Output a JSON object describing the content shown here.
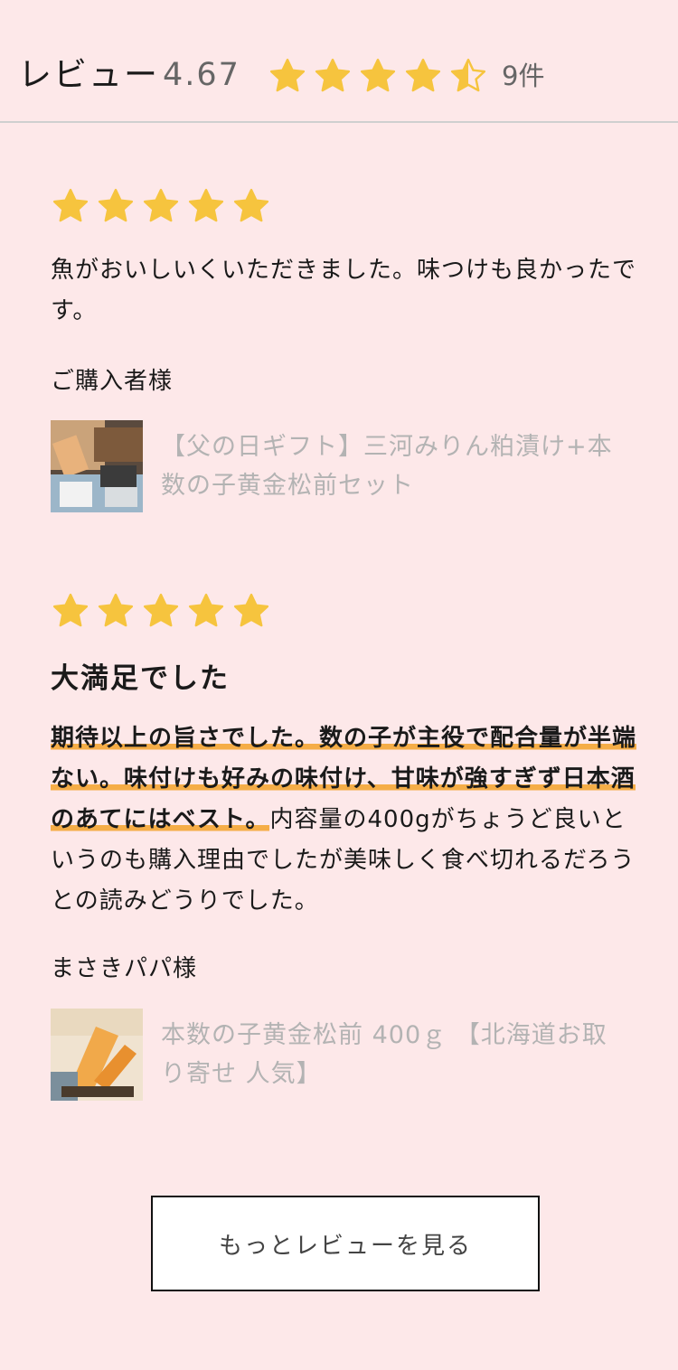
{
  "header": {
    "title": "レビュー",
    "score": "4.67",
    "rating": 4.67,
    "count": "9件"
  },
  "colors": {
    "background": "#fde8e9",
    "star": "#f6c43e",
    "highlight": "#f5ad47"
  },
  "reviews": [
    {
      "rating": 5,
      "body": "魚がおいしいくいただきました。味つけも良かったです。",
      "reviewer": "ご購入者様",
      "product_title": "【父の日ギフト】三河みりん粕漬け+本数の子黄金松前セット",
      "thumb_icon": "product-photo-fish-gift-set"
    },
    {
      "rating": 5,
      "title": "大満足でした",
      "body_highlight": "期待以上の旨さでした。数の子が主役で配合量が半端ない。味付けも好みの味付け、甘味が強すぎず日本酒のあてにはベスト。",
      "body_rest": "内容量の400gがちょうど良いというのも購入理由でしたが美味しく食べ切れるだろうとの読みどうりでした。",
      "reviewer": "まさきパパ様",
      "product_title": "本数の子黄金松前 400ｇ 【北海道お取り寄せ 人気】",
      "thumb_icon": "product-photo-kazunoko-matsumae"
    }
  ],
  "more_button": "もっとレビューを見る"
}
